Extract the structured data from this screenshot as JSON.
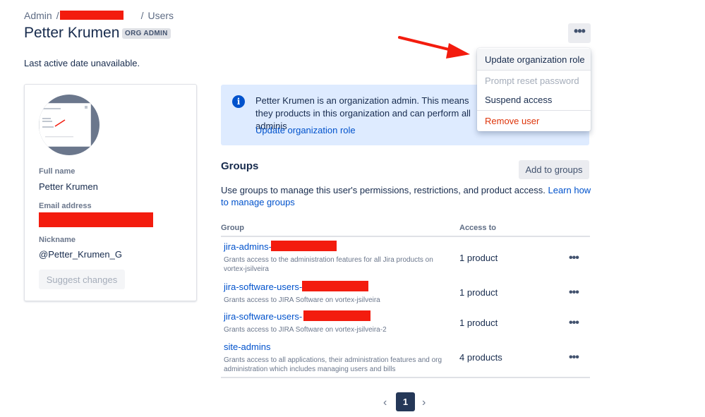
{
  "breadcrumb": {
    "root": "Admin",
    "separator": "/",
    "current": "Users"
  },
  "header": {
    "title": "Petter Krumen",
    "badge": "ORG ADMIN",
    "more_icon": "more-horizontal-icon"
  },
  "last_active": "Last active date unavailable.",
  "profile": {
    "full_name_label": "Full name",
    "full_name": "Petter Krumen",
    "email_label": "Email address",
    "nickname_label": "Nickname",
    "nickname": "@Petter_Krumen_G",
    "suggest_button": "Suggest changes"
  },
  "info": {
    "icon": "info-icon",
    "text": "Petter Krumen is an organization admin. This means they products in this organization and can perform all adminis",
    "link": "Update organization role"
  },
  "menu": {
    "items": [
      {
        "label": "Update organization role",
        "state": "hover"
      },
      {
        "label": "Prompt reset password",
        "state": "disabled"
      },
      {
        "label": "Suspend access",
        "state": "normal"
      },
      {
        "label": "Remove user",
        "state": "danger"
      }
    ]
  },
  "groups": {
    "heading": "Groups",
    "add_button": "Add to groups",
    "description": "Use groups to manage this user's permissions, restrictions, and product access.",
    "description_link": "Learn how to manage groups",
    "columns": [
      "Group",
      "Access to"
    ],
    "rows": [
      {
        "name": "jira-admins-",
        "desc": "Grants access to the administration features for all Jira products on vortex-jsilveira",
        "access": "1 product"
      },
      {
        "name": "jira-software-users-",
        "desc": "Grants access to JIRA Software on vortex-jsilveira",
        "access": "1 product"
      },
      {
        "name": "jira-software-users-",
        "desc": "Grants access to JIRA Software on vortex-jsilveira-2",
        "access": "1 product"
      },
      {
        "name": "site-admins",
        "desc": "Grants access to all applications, their administration features and org administration which includes managing users and bills",
        "access": "4 products"
      }
    ]
  },
  "pagination": {
    "current": "1",
    "prev_icon": "chevron-left-icon",
    "next_icon": "chevron-right-icon"
  },
  "colors": {
    "accent": "#0052cc",
    "danger": "#de350b",
    "redaction": "#f31c0e",
    "info_bg": "#deebff",
    "annotation_arrow": "#f31c0e"
  }
}
